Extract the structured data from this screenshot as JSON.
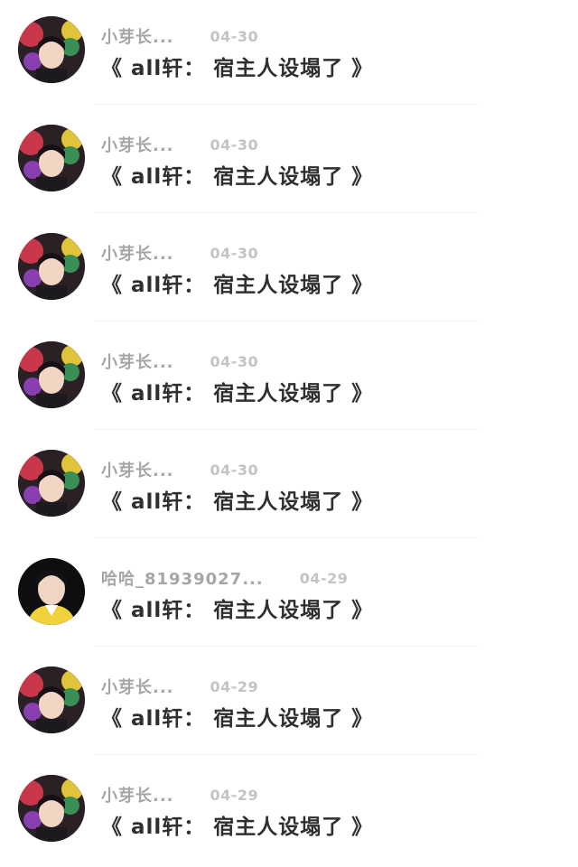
{
  "messages": [
    {
      "username": "小芽长...",
      "date": "04-30",
      "title": "《 all轩： 宿主人设塌了 》",
      "avatar": "photo-colorful"
    },
    {
      "username": "小芽长...",
      "date": "04-30",
      "title": "《 all轩： 宿主人设塌了 》",
      "avatar": "photo-colorful"
    },
    {
      "username": "小芽长...",
      "date": "04-30",
      "title": "《 all轩： 宿主人设塌了 》",
      "avatar": "photo-colorful"
    },
    {
      "username": "小芽长...",
      "date": "04-30",
      "title": "《 all轩： 宿主人设塌了 》",
      "avatar": "photo-colorful"
    },
    {
      "username": "小芽长...",
      "date": "04-30",
      "title": "《 all轩： 宿主人设塌了 》",
      "avatar": "photo-colorful"
    },
    {
      "username": "哈哈_81939027...",
      "date": "04-29",
      "title": "《 all轩： 宿主人设塌了 》",
      "avatar": "photo-yellow"
    },
    {
      "username": "小芽长...",
      "date": "04-29",
      "title": "《 all轩： 宿主人设塌了 》",
      "avatar": "photo-colorful"
    },
    {
      "username": "小芽长...",
      "date": "04-29",
      "title": "《 all轩： 宿主人设塌了 》",
      "avatar": "photo-colorful"
    }
  ],
  "colors": {
    "username": "#a6a6a6",
    "date": "#c4c4c4",
    "title": "#2f2f2f",
    "divider": "#f2f2f2"
  }
}
